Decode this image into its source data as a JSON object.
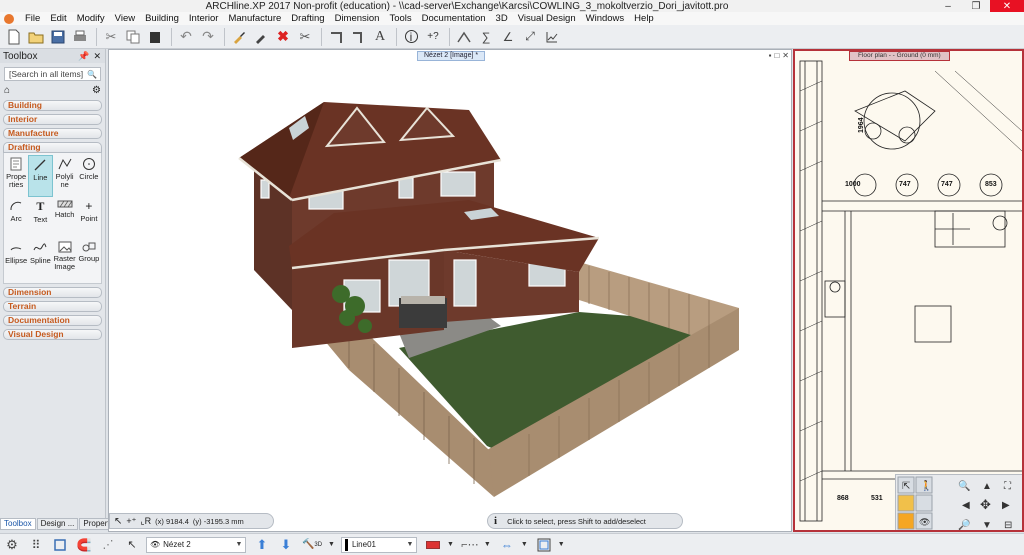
{
  "window": {
    "title": "ARCHline.XP 2017 Non-profit (education) - \\\\cad-server\\Exchange\\Karcsi\\COWLING_3_mokoltverzio_Dori_javitott.pro",
    "minimize": "–",
    "maximize": "❐",
    "close": "✕"
  },
  "menu": [
    "File",
    "Edit",
    "Modify",
    "View",
    "Building",
    "Interior",
    "Manufacture",
    "Drafting",
    "Dimension",
    "Tools",
    "Documentation",
    "3D",
    "Visual Design",
    "Windows",
    "Help"
  ],
  "toolbox": {
    "title": "Toolbox",
    "search_placeholder": "[Search in all items]",
    "categories_top": [
      "Building",
      "Interior",
      "Manufacture"
    ],
    "open_category": "Drafting",
    "tools": [
      {
        "label": "Prope rties",
        "icon": "properties-icon"
      },
      {
        "label": "Line",
        "icon": "line-icon"
      },
      {
        "label": "Polyli ne",
        "icon": "polyline-icon"
      },
      {
        "label": "Circle",
        "icon": "circle-icon"
      },
      {
        "label": "Arc",
        "icon": "arc-icon"
      },
      {
        "label": "Text",
        "icon": "text-icon"
      },
      {
        "label": "Hatch",
        "icon": "hatch-icon"
      },
      {
        "label": "Point",
        "icon": "point-icon"
      },
      {
        "label": "Ellipse",
        "icon": "ellipse-icon"
      },
      {
        "label": "Spline",
        "icon": "spline-icon"
      },
      {
        "label": "Raster Image",
        "icon": "raster-image-icon"
      },
      {
        "label": "Group",
        "icon": "group-icon"
      }
    ],
    "categories_bottom": [
      "Dimension",
      "Terrain",
      "Documentation",
      "Visual Design"
    ],
    "tabs": [
      "Toolbox",
      "Design ...",
      "Propert..."
    ]
  },
  "view3d": {
    "tab_label": "Nézet 2 [Image] *",
    "coord_x": "(x) 9184.4",
    "coord_y": "(y) -3195.3 mm",
    "hint": "Click to select, press Shift to add/deselect"
  },
  "floorplan": {
    "tab_label": "Floor plan - - Ground (0 mm)",
    "dims": [
      "1000",
      "747",
      "747",
      "853",
      "1964",
      "868",
      "531"
    ]
  },
  "bottombar": {
    "view_combo": "Nézet 2",
    "layer_combo": "Line01",
    "mode_3d": "3D"
  },
  "colors": {
    "accent": "#c65a1e",
    "floorplan_border": "#b5323a",
    "roof": "#6a3324",
    "brick": "#6e3a2c",
    "grass": "#3f5b2f",
    "fence": "#b89d80"
  }
}
